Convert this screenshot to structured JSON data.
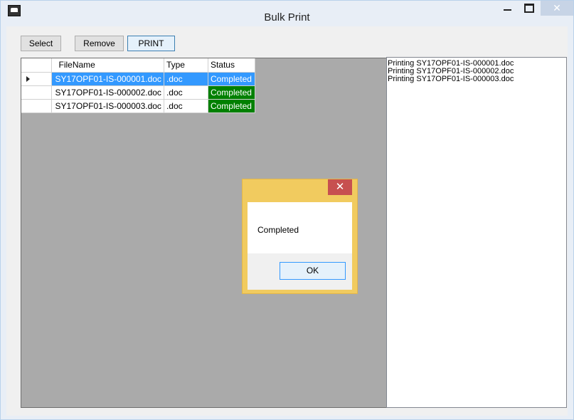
{
  "window": {
    "title": "Bulk Print",
    "close_glyph": "✕",
    "icons": {
      "app": "app-icon",
      "minimize": "minimize-icon",
      "maximize": "maximize-icon",
      "close": "close-icon"
    }
  },
  "toolbar": {
    "select_label": "Select",
    "remove_label": "Remove",
    "print_label": "PRINT"
  },
  "grid": {
    "columns": [
      "FileName",
      "Type",
      "Status"
    ],
    "rows": [
      {
        "file": "SY17OPF01-IS-000001.doc",
        "type": ".doc",
        "status": "Completed",
        "selected": true
      },
      {
        "file": "SY17OPF01-IS-000002.doc",
        "type": ".doc",
        "status": "Completed",
        "selected": false
      },
      {
        "file": "SY17OPF01-IS-000003.doc",
        "type": ".doc",
        "status": "Completed",
        "selected": false
      }
    ],
    "background_color": "#aaaaaa",
    "selected_color": "#3399ff",
    "completed_color": "#008000"
  },
  "log": {
    "lines": [
      "Printing SY17OPF01-IS-000001.doc",
      "Printing SY17OPF01-IS-000002.doc",
      "Printing SY17OPF01-IS-000003.doc"
    ]
  },
  "dialog": {
    "message": "Completed",
    "ok_label": "OK",
    "close_glyph": "✕",
    "frame_color": "#f1cb5f"
  }
}
